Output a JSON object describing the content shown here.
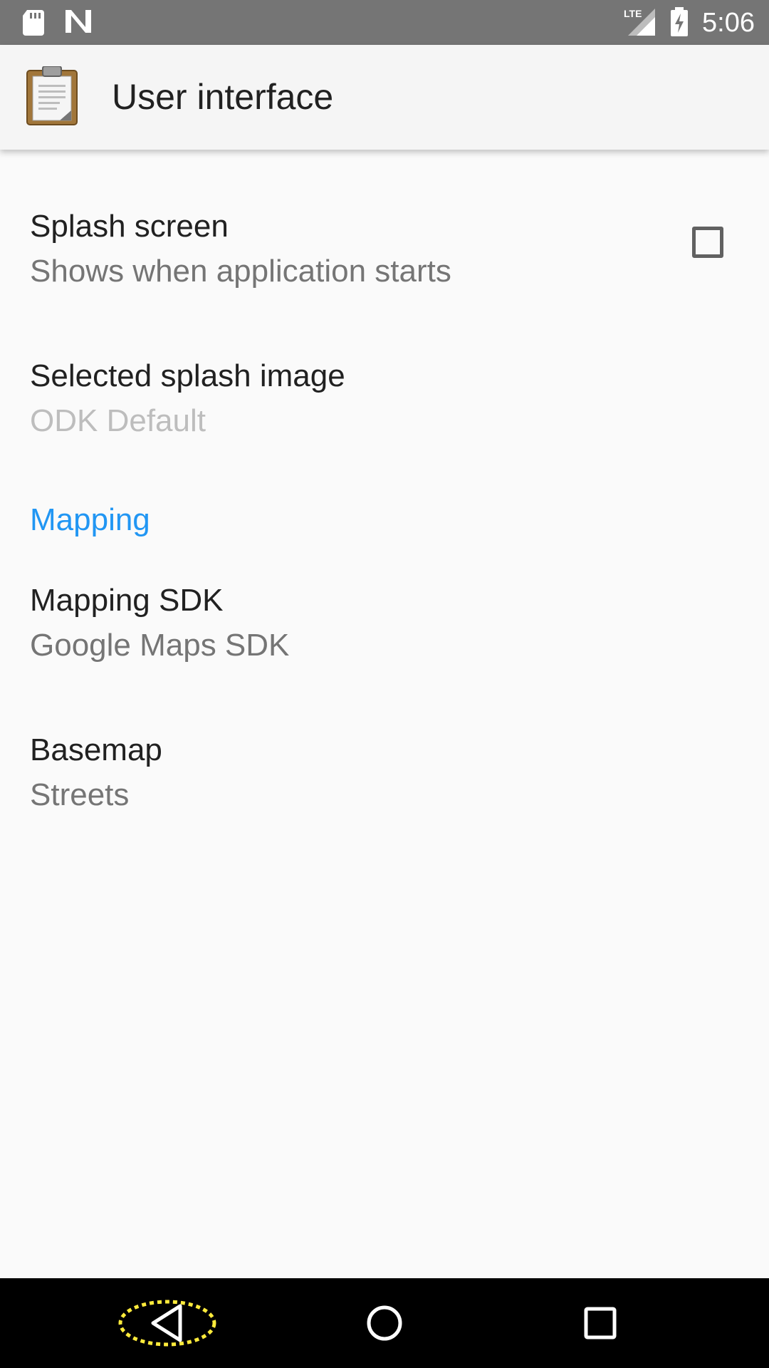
{
  "status_bar": {
    "time": "5:06",
    "network": "LTE",
    "icons": [
      "sd-card-icon",
      "n-notification-icon",
      "signal-icon",
      "battery-charging-icon"
    ]
  },
  "app_bar": {
    "title": "User interface",
    "icon": "clipboard-icon"
  },
  "preferences": {
    "splash_screen": {
      "title": "Splash screen",
      "summary": "Shows when application starts",
      "checked": false
    },
    "splash_image": {
      "title": "Selected splash image",
      "summary": "ODK Default"
    },
    "mapping_category": {
      "label": "Mapping"
    },
    "mapping_sdk": {
      "title": "Mapping SDK",
      "summary": "Google Maps SDK"
    },
    "basemap": {
      "title": "Basemap",
      "summary": "Streets"
    }
  },
  "nav_bar": {
    "icons": [
      "back-icon",
      "home-icon",
      "recents-icon"
    ]
  },
  "colors": {
    "status_bar": "#757575",
    "app_bar": "#F5F5F5",
    "background": "#FAFAFA",
    "accent": "#2196F3",
    "primary_text": "#212121",
    "secondary_text": "#757575",
    "disabled_text": "#BDBDBD",
    "highlight": "#FFEB3B"
  }
}
